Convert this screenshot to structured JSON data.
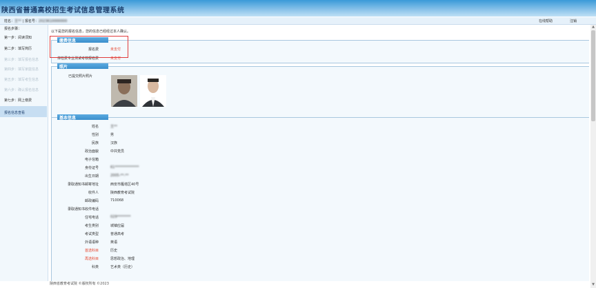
{
  "header": {
    "title": "陕西省普通高校招生考试信息管理系统"
  },
  "userbar": {
    "name_label": "姓名：",
    "name_value": "王**",
    "separator": " | ",
    "id_label": "报名号：",
    "id_value": "2023610000000",
    "help": "在线帮助",
    "logout": "注销"
  },
  "sidebar": {
    "title": "报名步骤：",
    "steps": [
      "第一步：阅读须知",
      "第二步：填写简历",
      "第三步：填写报名信息",
      "第四步：填写家庭信息",
      "第五步：填写考生信息",
      "第六步：确认报名信息",
      "第七步：网上缴费"
    ],
    "active": "报名信息查看"
  },
  "main": {
    "notice": "以下是您的报名信息，您的信息已经经过本人确认。",
    "fee_panel": {
      "title": "缴费信息",
      "rows": [
        {
          "label": "报名费",
          "value": "未支付"
        },
        {
          "label": "体检费专业测试考核报名费",
          "value": "未支付"
        }
      ]
    },
    "photo_panel": {
      "title": "照片",
      "label": "已提交照片照片"
    },
    "basic_panel": {
      "title": "基本信息",
      "rows": [
        {
          "label": "姓名",
          "value": "王**"
        },
        {
          "label": "性别",
          "value": "男"
        },
        {
          "label": "民族",
          "value": "汉族"
        },
        {
          "label": "政治面貌",
          "value": "中共党员"
        },
        {
          "label": "电子信箱",
          "value": ""
        },
        {
          "label": "身份证号",
          "value": "61**************"
        },
        {
          "label": "出生日期",
          "value": "2005-**-**"
        },
        {
          "label": "录取通知书邮寄地址",
          "value": "西安市雁塔区40号"
        },
        {
          "label": "收件人",
          "value": "陕西教育考试院"
        },
        {
          "label": "邮政编码",
          "value": "710068"
        },
        {
          "label": "录取通知书收件电话",
          "value": ""
        },
        {
          "label": "住宅电话",
          "value": "029********"
        },
        {
          "label": "考生类别",
          "value": "城镇应届"
        },
        {
          "label": "考试类型",
          "value": "普通高考"
        },
        {
          "label": "外语语种",
          "value": "英语"
        },
        {
          "label": "首选科目",
          "value": "历史"
        },
        {
          "label": "再选科目",
          "value": "思想政治、地理"
        },
        {
          "label": "科类",
          "value": "艺术类（历史）"
        }
      ]
    }
  },
  "footer": "陕西省教育考试院 ©版权所有 ©2023"
}
